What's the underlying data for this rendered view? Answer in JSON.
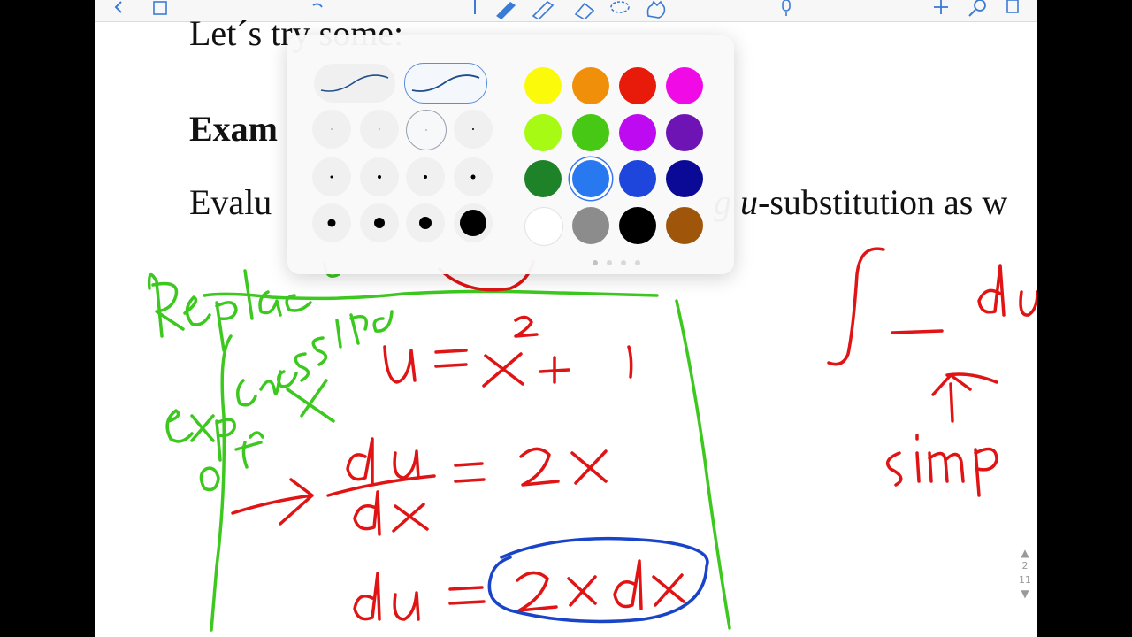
{
  "document": {
    "lines": {
      "line1": "Let´s try some:",
      "line2": "Exam",
      "line3_start": "Evalu",
      "line3_end_italic": "g u",
      "line3_end": "-substitution as w"
    }
  },
  "handwriting": {
    "green_label": "Replace expressions of x",
    "eq1": "u = x² + 1",
    "eq2": "du/dx = 2x",
    "eq3": "du = 2x dx",
    "right_integral": "∫ _ du",
    "right_note": "simp"
  },
  "palette": {
    "colors": [
      "#fafa0a",
      "#f0900a",
      "#e81a0a",
      "#f00ae6",
      "#a6fa14",
      "#46c814",
      "#be0af0",
      "#6e14b4",
      "#1e8228",
      "#2878f0",
      "#1e46dc",
      "#0a0a96",
      "#ffffff",
      "#8c8c8c",
      "#000000",
      "#a0560a"
    ],
    "selected_color": "#2878f0",
    "stroke_color": "#1f4e8c"
  },
  "page_indicator": {
    "current": "2",
    "total": "11"
  }
}
